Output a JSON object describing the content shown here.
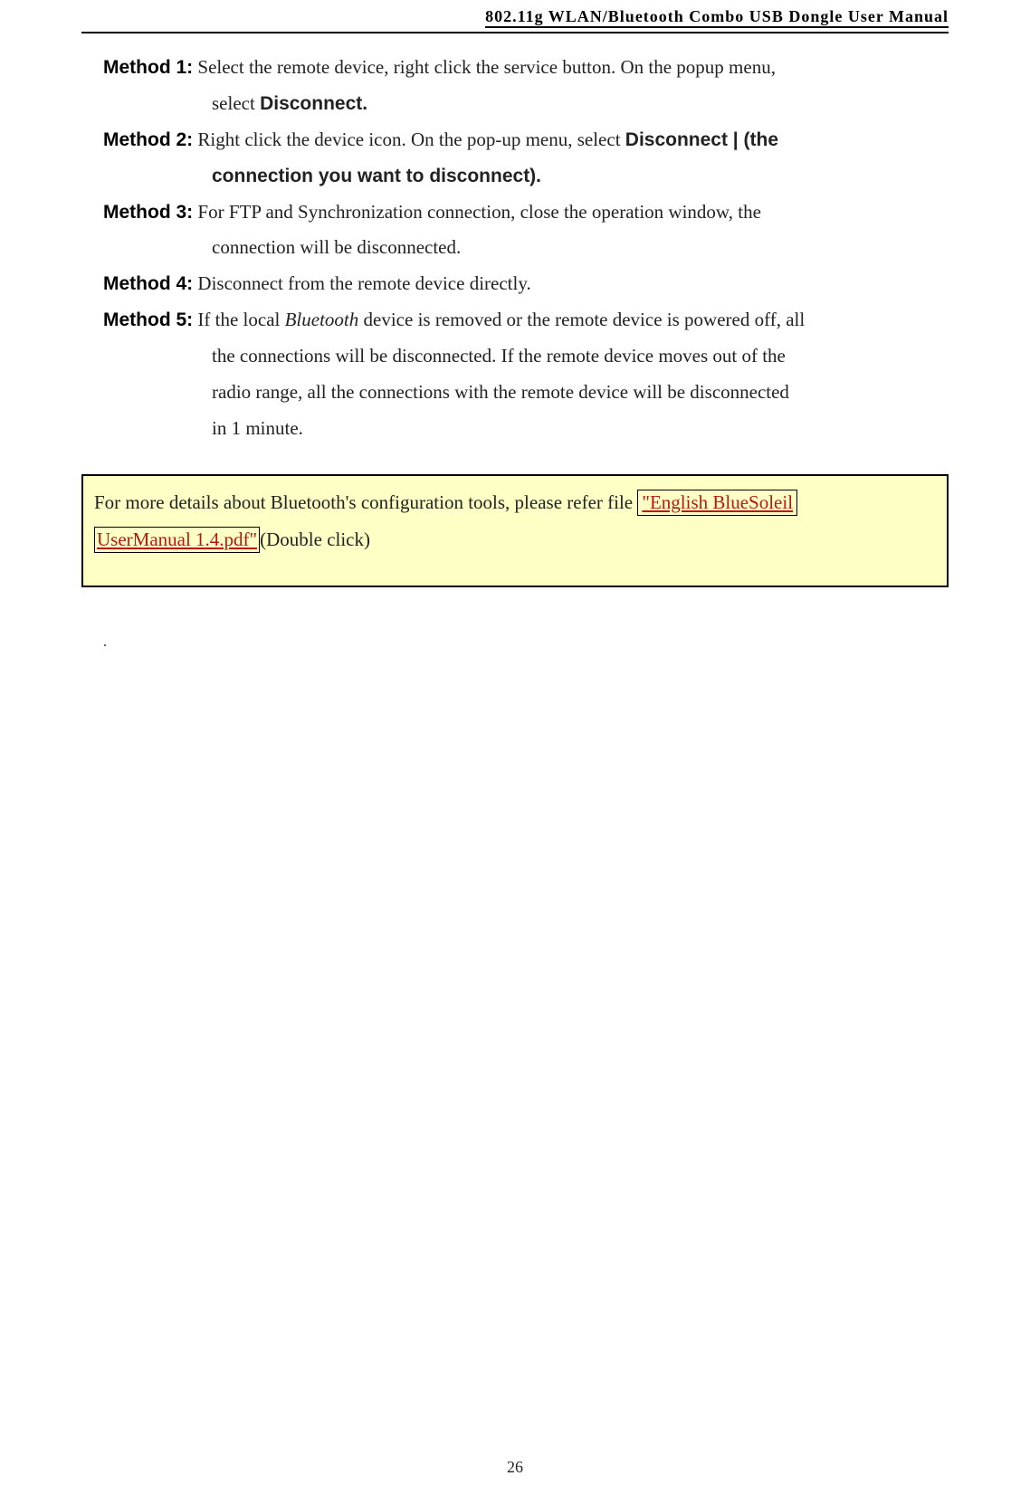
{
  "header": {
    "title": "802.11g  WLAN/Bluetooth  Combo  USB  Dongle  User  Manual"
  },
  "methods": {
    "m1": {
      "label": "Method 1:",
      "line1": " Select the remote device, right click the service button. On the popup menu,",
      "line2": "select ",
      "line2_bold": "Disconnect."
    },
    "m2": {
      "label": "Method 2:",
      "line1": " Right click the device icon. On the pop-up menu, select ",
      "line1_bold": "Disconnect | (the",
      "line2_bold": "connection you want to disconnect)."
    },
    "m3": {
      "label": "Method 3:",
      "line1": " For FTP and Synchronization connection, close the operation window, the",
      "line2": "connection will be disconnected."
    },
    "m4": {
      "label": "Method 4:",
      "line1": " Disconnect from the remote device directly."
    },
    "m5": {
      "label": "Method 5:",
      "line1a": " If the local ",
      "line1_ital": "Bluetooth",
      "line1b": " device is removed or the remote device is powered off, all",
      "line2": "the connections will be disconnected. If the remote device moves out of the",
      "line3": "radio range, all the connections with   the remote device will be disconnected",
      "line4": "in 1 minute."
    }
  },
  "callout": {
    "pre": "For more details about Bluetooth's configuration tools, please refer file ",
    "link1_text": "\"English BlueSoleil",
    "link2_text": "UserManual 1.4.pdf\"",
    "post": "(Double click)"
  },
  "dot": ".",
  "footer": {
    "page": "26"
  }
}
